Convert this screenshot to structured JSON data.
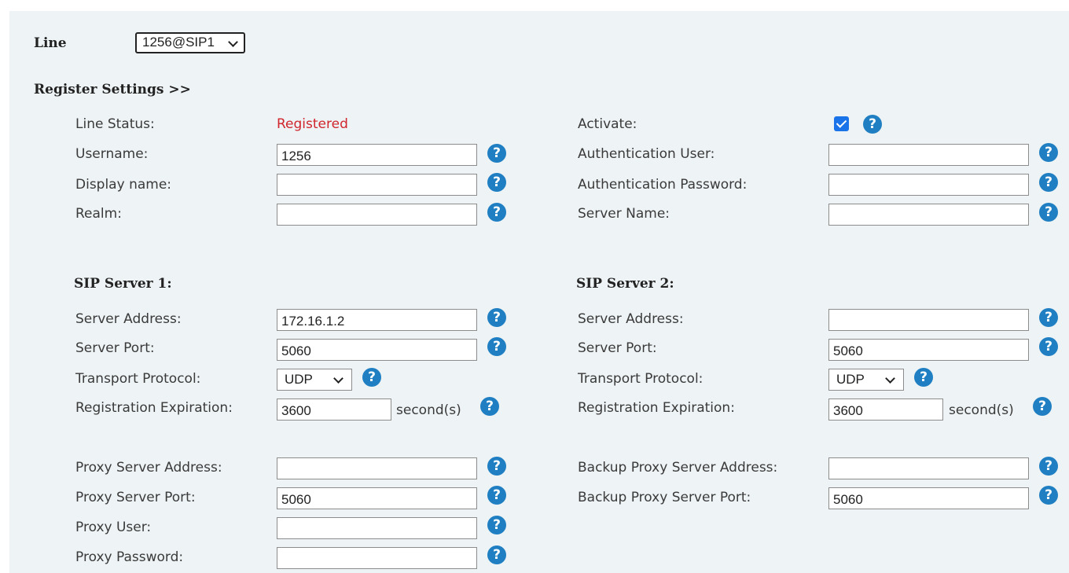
{
  "line": {
    "label": "Line",
    "selected": "1256@SIP1"
  },
  "register_settings": {
    "heading": "Register Settings >>"
  },
  "left": {
    "line_status_label": "Line Status:",
    "line_status_value": "Registered",
    "username_label": "Username:",
    "username_value": "1256",
    "display_name_label": "Display name:",
    "display_name_value": "",
    "realm_label": "Realm:",
    "realm_value": ""
  },
  "right": {
    "activate_label": "Activate:",
    "activate_checked": true,
    "auth_user_label": "Authentication User:",
    "auth_user_value": "",
    "auth_password_label": "Authentication Password:",
    "auth_password_value": "",
    "server_name_label": "Server Name:",
    "server_name_value": ""
  },
  "sip1": {
    "heading": "SIP Server 1:",
    "server_address_label": "Server Address:",
    "server_address_value": "172.16.1.2",
    "server_port_label": "Server Port:",
    "server_port_value": "5060",
    "transport_label": "Transport Protocol:",
    "transport_value": "UDP",
    "expiration_label": "Registration Expiration:",
    "expiration_value": "3600",
    "expiration_unit": "second(s)"
  },
  "sip2": {
    "heading": "SIP Server 2:",
    "server_address_label": "Server Address:",
    "server_address_value": "",
    "server_port_label": "Server Port:",
    "server_port_value": "5060",
    "transport_label": "Transport Protocol:",
    "transport_value": "UDP",
    "expiration_label": "Registration Expiration:",
    "expiration_value": "3600",
    "expiration_unit": "second(s)"
  },
  "proxy": {
    "address_label": "Proxy Server Address:",
    "address_value": "",
    "port_label": "Proxy Server Port:",
    "port_value": "5060",
    "user_label": "Proxy User:",
    "user_value": "",
    "password_label": "Proxy Password:",
    "password_value": ""
  },
  "backup_proxy": {
    "address_label": "Backup Proxy Server Address:",
    "address_value": "",
    "port_label": "Backup Proxy Server Port:",
    "port_value": "5060"
  },
  "help_glyph": "?",
  "icons": {
    "help": "question-circle-icon",
    "checkbox": "checkbox-checked-icon",
    "dropdown": "chevron-down-icon"
  },
  "colors": {
    "background": "#eef3f5",
    "help_icon": "#1f7fc2",
    "status_registered": "#d0262d",
    "checkbox": "#1a73e8"
  }
}
